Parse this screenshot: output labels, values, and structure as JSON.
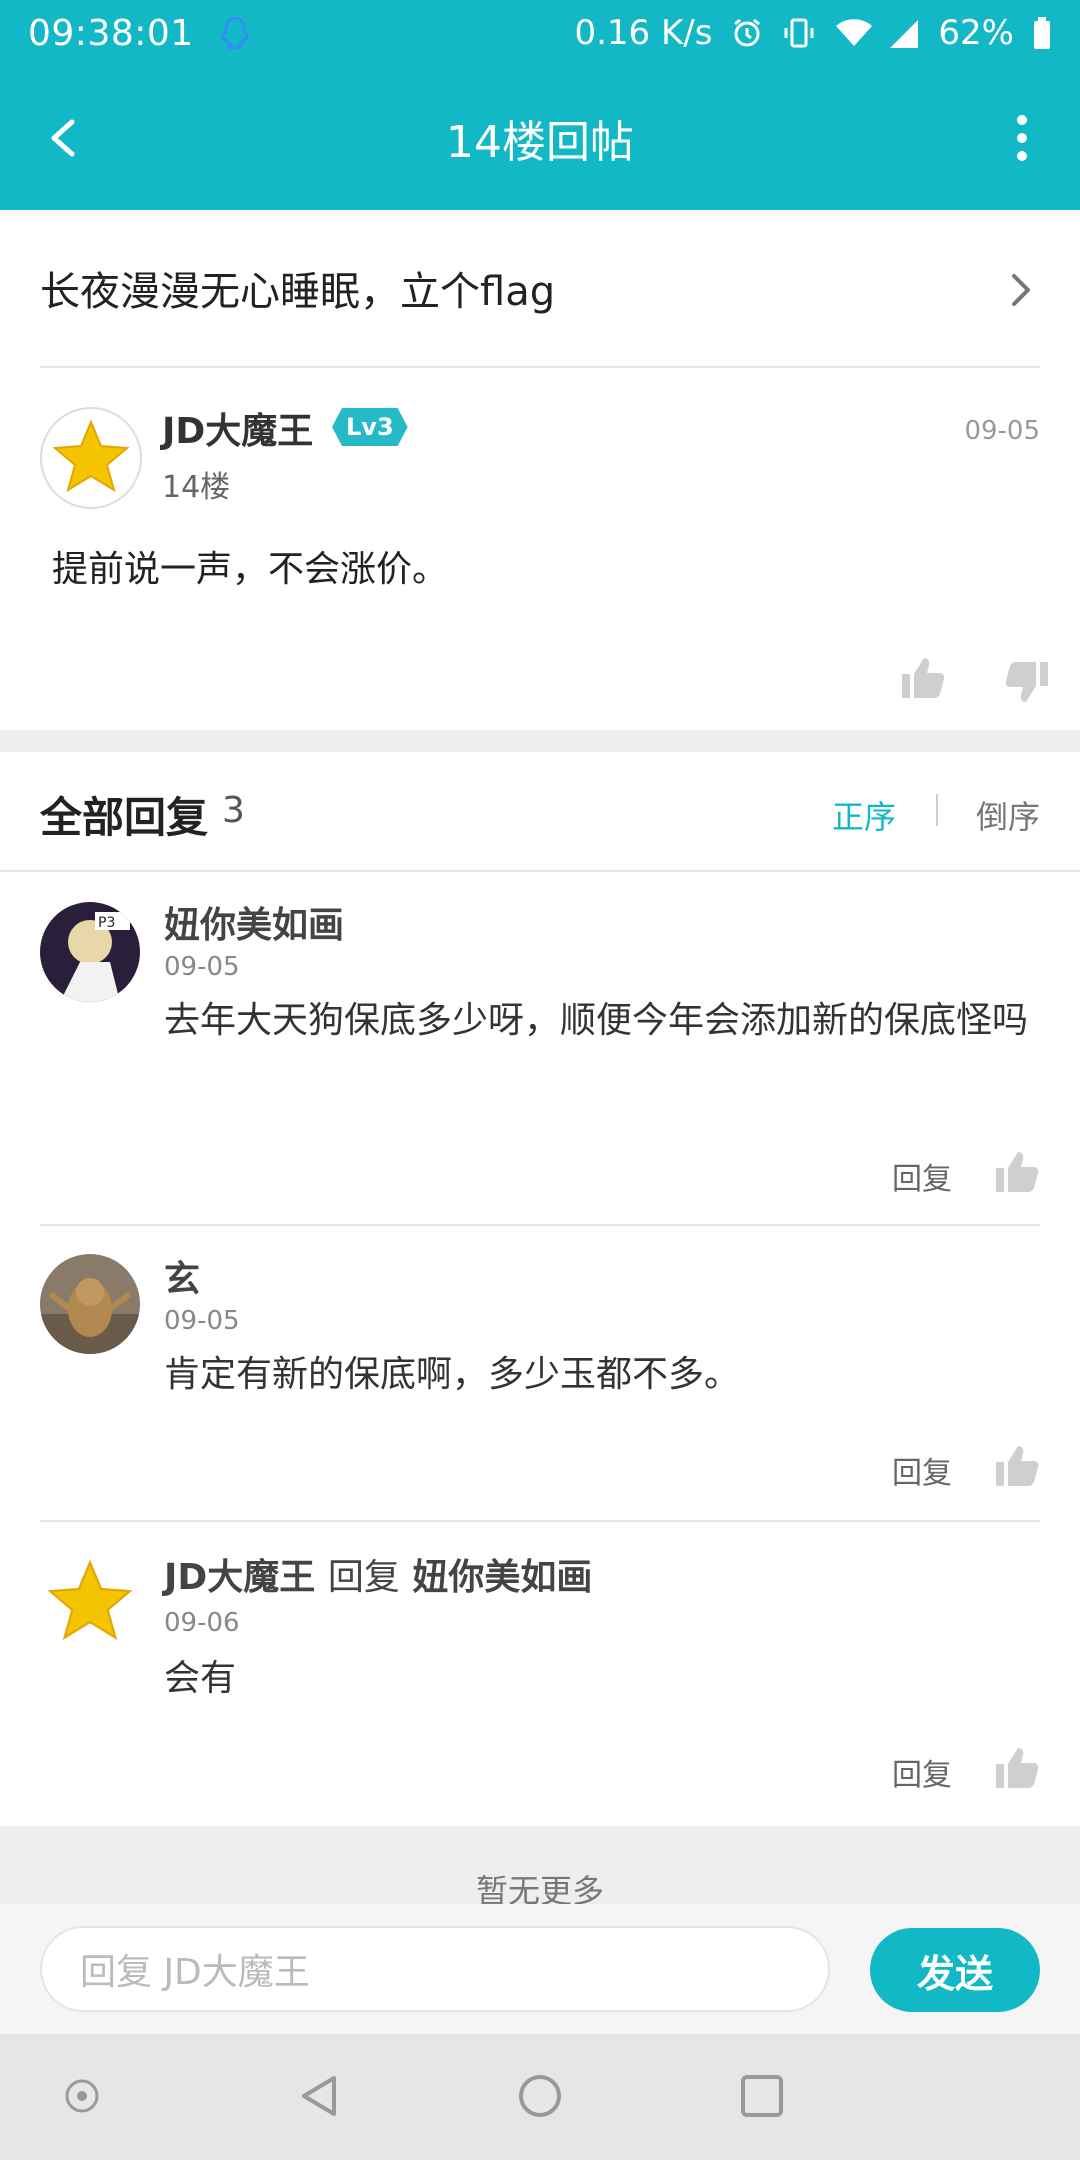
{
  "status_bar": {
    "time": "09:38:01",
    "net_speed": "0.16 K/s",
    "battery": "62%"
  },
  "header": {
    "title": "14楼回帖"
  },
  "thread": {
    "title": "长夜漫漫无心睡眠，立个flag"
  },
  "post": {
    "author": "JD大魔王",
    "level": "Lv3",
    "floor": "14楼",
    "date": "09-05",
    "content": "提前说一声，不会涨价。"
  },
  "replies_header": {
    "label": "全部回复",
    "count": "3",
    "sort_asc": "正序",
    "sort_desc": "倒序"
  },
  "replies": [
    {
      "author": "妞你美如画",
      "date": "09-05",
      "content": "去年大天狗保底多少呀，顺便今年会添加新的保底怪吗",
      "reply_label": "回复"
    },
    {
      "author": "玄",
      "date": "09-05",
      "content": "肯定有新的保底啊，多少玉都不多。",
      "reply_label": "回复"
    },
    {
      "author": "JD大魔王",
      "reply_word": "回复",
      "reply_to": "妞你美如画",
      "date": "09-06",
      "content": "会有",
      "reply_label": "回复"
    }
  ],
  "no_more": "暂无更多",
  "reply_bar": {
    "placeholder": "回复 JD大魔王",
    "send_label": "发送"
  },
  "colors": {
    "accent": "#13b8c6",
    "star": "#f5c400"
  }
}
